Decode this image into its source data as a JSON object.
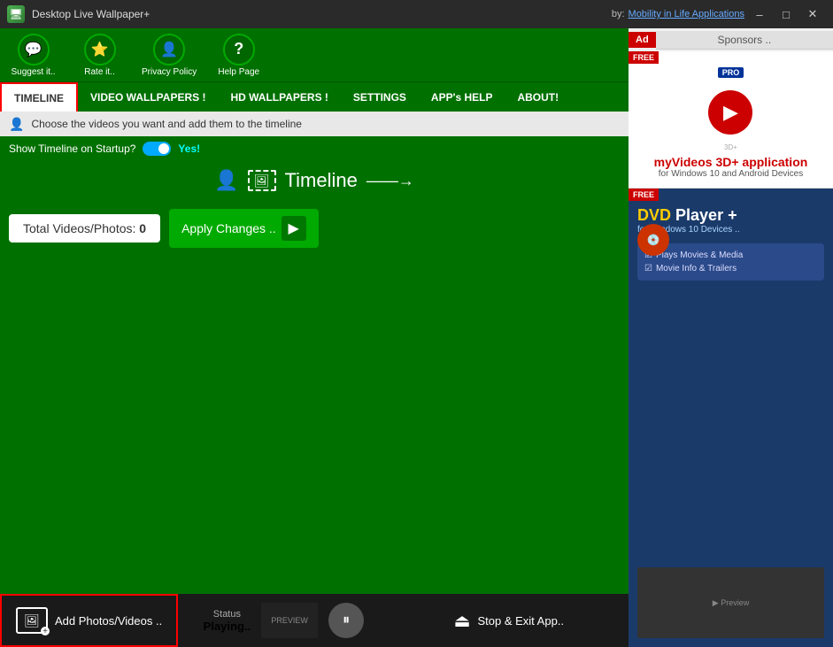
{
  "titlebar": {
    "app_name": "Desktop Live Wallpaper+",
    "by": "by:",
    "company": "Mobility in Life Applications",
    "minimize": "–",
    "maximize": "□",
    "close": "✕"
  },
  "top_icons": [
    {
      "id": "suggest",
      "icon": "💬",
      "label": "Suggest it.."
    },
    {
      "id": "rate",
      "icon": "⭐",
      "label": "Rate it.."
    },
    {
      "id": "privacy",
      "icon": "👤",
      "label": "Privacy Policy"
    },
    {
      "id": "help",
      "icon": "?",
      "label": "Help Page"
    }
  ],
  "nav_tabs": [
    {
      "id": "timeline",
      "label": "TIMELINE",
      "active": true
    },
    {
      "id": "video_wallpapers",
      "label": "VIDEO WALLPAPERS !",
      "active": false
    },
    {
      "id": "hd_wallpapers",
      "label": "HD WALLPAPERS !",
      "active": false
    },
    {
      "id": "settings",
      "label": "SETTINGS",
      "active": false
    },
    {
      "id": "app_help",
      "label": "APP's HELP",
      "active": false
    },
    {
      "id": "about",
      "label": "ABOUT!",
      "active": false
    }
  ],
  "subtitle": "Choose the videos you want and add them to the timeline",
  "show_timeline": {
    "label": "Show Timeline on Startup?",
    "toggle_state": "on",
    "yes_label": "Yes!"
  },
  "timeline_section": {
    "title": "Timeline",
    "total_label": "Total Videos/Photos:",
    "total_count": "0",
    "apply_btn": "Apply Changes .."
  },
  "bottom_bar": {
    "add_btn": "Add Photos/Videos ..",
    "status_label": "Status",
    "status_value": "Playing..",
    "stop_btn": "Stop & Exit App.."
  },
  "ad_panel": {
    "ad_label": "Ad",
    "sponsors_label": "Sponsors ..",
    "free_badge": "FREE",
    "ad1": {
      "pro_badge": "PRO",
      "badge_3d": "3D+",
      "title": "myVideos 3D+ application",
      "subtitle": "for Windows 10 and Android Devices"
    },
    "ad2": {
      "free_badge": "FREE",
      "dvd_title": "DVD Player +",
      "dvd_plus_sign": "+",
      "subtitle": "for Windows 10 Devices ..",
      "feature1": "Plays Movies & Media",
      "feature2": "Movie Info & Trailers"
    }
  },
  "icons": {
    "person": "👤",
    "photo": "🖼",
    "arrow_right": "→",
    "play": "▶",
    "pause": "⏸",
    "add": "+",
    "exit": "⏏",
    "dvd": "💿",
    "film": "🎬"
  }
}
